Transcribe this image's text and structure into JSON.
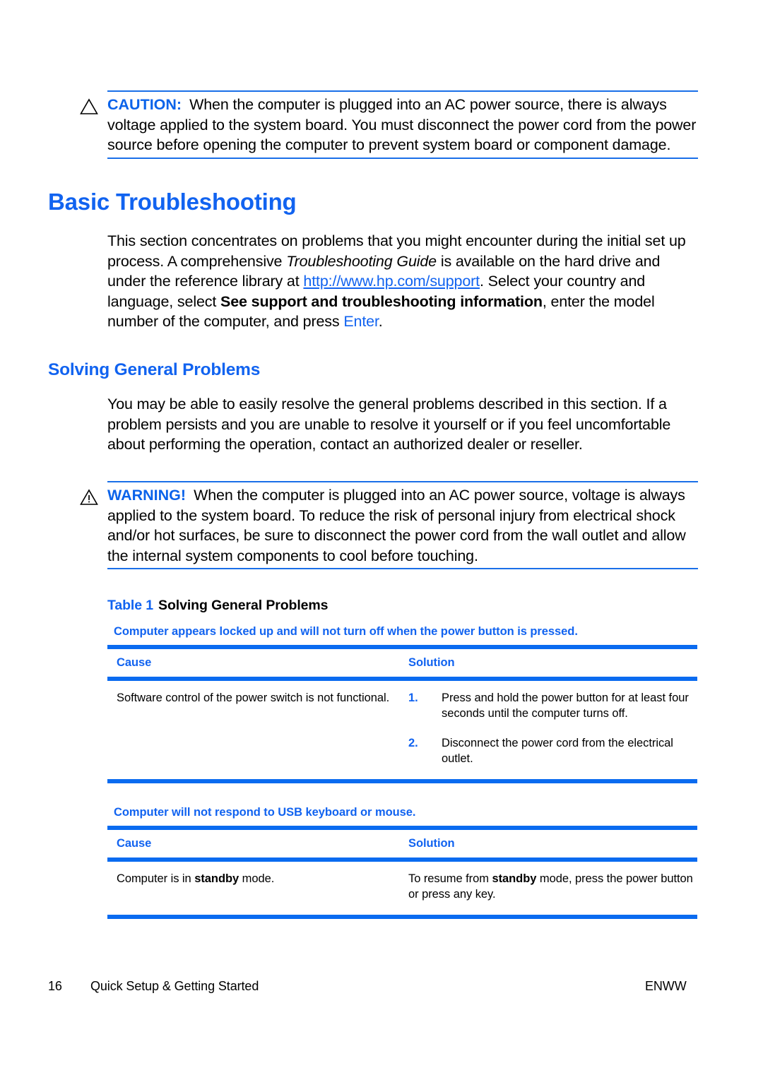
{
  "colors": {
    "accent_blue": "#1163F0",
    "rule_blue": "#0A6BF0",
    "text_black": "#000000",
    "page_background": "#FFFFFF"
  },
  "caution": {
    "icon": "warning-triangle-icon",
    "label": "CAUTION:",
    "text": "When the computer is plugged into an AC power source, there is always voltage applied to the system board. You must disconnect the power cord from the power source before opening the computer to prevent system board or component damage."
  },
  "section_basic": {
    "heading": "Basic Troubleshooting",
    "paragraph": {
      "part1": "This section concentrates on problems that you might encounter during the initial set up process. A comprehensive ",
      "italic1": "Troubleshooting Guide",
      "part2": " is available on the hard drive and under the reference library at ",
      "link_text": "http://www.hp.com/support",
      "part3": ". Select your country and language, select ",
      "bold1": "See support and troubleshooting information",
      "part4": ", enter the model number of the computer, and press ",
      "key": "Enter",
      "part5": "."
    }
  },
  "section_solving": {
    "heading": "Solving General Problems",
    "paragraph": "You may be able to easily resolve the general problems described in this section. If a problem persists and you are unable to resolve it yourself or if you feel uncomfortable about performing the operation, contact an authorized dealer or reseller."
  },
  "warning": {
    "icon": "warning-triangle-exclamation-icon",
    "label": "WARNING!",
    "text": "When the computer is plugged into an AC power source, voltage is always applied to the system board. To reduce the risk of personal injury from electrical shock and/or hot surfaces, be sure to disconnect the power cord from the wall outlet and allow the internal system components to cool before touching."
  },
  "table_caption": {
    "number": "Table 1",
    "title": "Solving General Problems"
  },
  "table_headers": {
    "cause": "Cause",
    "solution": "Solution"
  },
  "tables": [
    {
      "title": "Computer appears locked up and will not turn off when the power button is pressed.",
      "cause": "Software control of the power switch is not functional.",
      "solution_steps": [
        {
          "num": "1.",
          "text": "Press and hold the power button for at least four seconds until the computer turns off."
        },
        {
          "num": "2.",
          "text": "Disconnect the power cord from the electrical outlet."
        }
      ]
    },
    {
      "title": "Computer will not respond to USB keyboard or mouse.",
      "cause_parts": {
        "pre": "Computer is in ",
        "bold": "standby",
        "post": " mode."
      },
      "solution_parts": {
        "pre": "To resume from ",
        "bold": "standby",
        "post": " mode, press the power button or press any key."
      }
    }
  ],
  "footer": {
    "page_number": "16",
    "document_title": "Quick Setup & Getting Started",
    "language_code": "ENWW"
  }
}
